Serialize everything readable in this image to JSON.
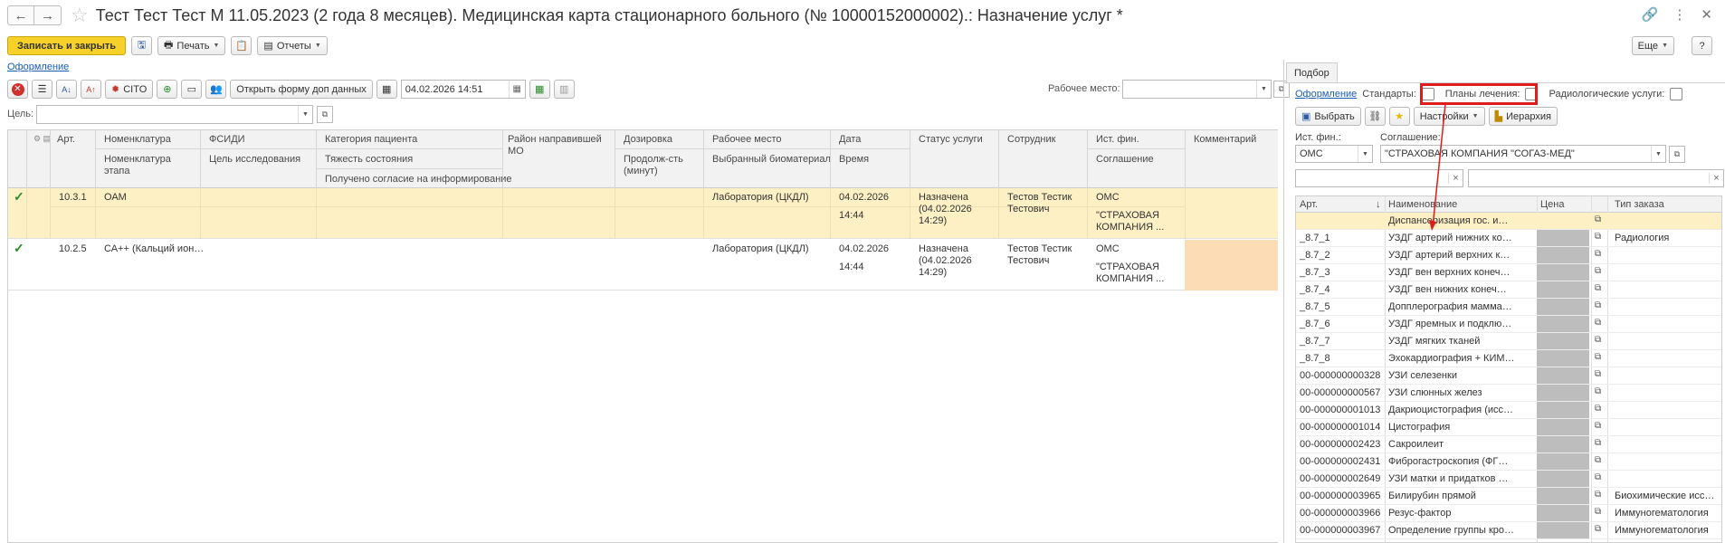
{
  "window": {
    "title": "Тест Тест Тест М 11.05.2023 (2 года 8 месяцев). Медицинская карта стационарного больного (№ 10000152000002).: Назначение услуг *"
  },
  "toolbar": {
    "save_close": "Записать и закрыть",
    "print": "Печать",
    "reports": "Отчеты",
    "more": "Еще",
    "help": "?"
  },
  "oformlenie": "Оформление",
  "toolbar2": {
    "cito": "CITO",
    "open_form": "Открыть форму доп данных",
    "date": "04.02.2026 14:51",
    "workplace_label": "Рабочее место:",
    "workplace_value": ""
  },
  "goal_label": "Цель:",
  "table": {
    "headers": {
      "art": "Арт.",
      "nomenclature": "Номенклатура",
      "nomenclature_stage": "Номенклатура",
      "nomenclature_stage2": "этапа",
      "fsidi": "ФСИДИ",
      "goal": "Цель исследования",
      "patient_cat": "Категория пациента",
      "severity": "Тяжесть состояния",
      "consent": "Получено согласие на информирование",
      "district": "Район направившей",
      "district2": "МО",
      "dosage": "Дозировка",
      "duration": "Продолж-сть",
      "duration2": "(минут)",
      "workplace": "Рабочее место",
      "biomaterial": "Выбранный биоматериал",
      "date": "Дата",
      "time": "Время",
      "status": "Статус услуги",
      "employee": "Сотрудник",
      "fin_source": "Ист. фин.",
      "agreement": "Соглашение",
      "comment": "Комментарий"
    },
    "rows": [
      {
        "art": "10.3.1",
        "nomenclature": "ОАМ",
        "workplace": "Лаборатория (ЦКДЛ)",
        "date": "04.02.2026",
        "time": "14:44",
        "status1": "Назначена",
        "status2": "(04.02.2026",
        "status3": "14:29)",
        "employee1": "Тестов Тестик",
        "employee2": "Тестович",
        "fin": "ОМС",
        "agreement1": "\"СТРАХОВАЯ",
        "agreement2": "КОМПАНИЯ ..."
      },
      {
        "art": "10.2.5",
        "nomenclature": "СА++ (Кальций ион…",
        "workplace": "Лаборатория (ЦКДЛ)",
        "date": "04.02.2026",
        "time": "14:44",
        "status1": "Назначена",
        "status2": "(04.02.2026",
        "status3": "14:29)",
        "employee1": "Тестов Тестик",
        "employee2": "Тестович",
        "fin": "ОМС",
        "agreement1": "\"СТРАХОВАЯ",
        "agreement2": "КОМПАНИЯ ..."
      }
    ]
  },
  "panel": {
    "tab": "Подбор",
    "oformlenie": "Оформление",
    "standards": "Стандарты:",
    "treatment_plans": "Планы лечения:",
    "radiology": "Радиологические услуги:",
    "select": "Выбрать",
    "settings": "Настройки",
    "hierarchy": "Иерархия",
    "fin_label": "Ист. фин.:",
    "fin_value": "ОМС",
    "agreement_label": "Соглашение:",
    "agreement_value": "\"СТРАХОВАЯ КОМПАНИЯ \"СОГАЗ-МЕД\"",
    "headers": {
      "art": "Арт.",
      "sort": "↓",
      "name": "Наименование",
      "price": "Цена",
      "order_type": "Тип заказа"
    },
    "items": [
      {
        "art": "",
        "name": "Диспансеризация гос. и…",
        "type": ""
      },
      {
        "art": "_8.7_1",
        "name": "УЗДГ артерий нижних ко…",
        "type": "Радиология"
      },
      {
        "art": "_8.7_2",
        "name": "УЗДГ артерий верхних к…",
        "type": ""
      },
      {
        "art": "_8.7_3",
        "name": "УЗДГ вен верхних конеч…",
        "type": ""
      },
      {
        "art": "_8.7_4",
        "name": "УЗДГ вен нижних конеч…",
        "type": ""
      },
      {
        "art": "_8.7_5",
        "name": "Допплерография маммa…",
        "type": ""
      },
      {
        "art": "_8.7_6",
        "name": "УЗДГ яремных и подклю…",
        "type": ""
      },
      {
        "art": "_8.7_7",
        "name": "УЗДГ мягких тканей",
        "type": ""
      },
      {
        "art": "_8.7_8",
        "name": "Эхокардиография + КИМ…",
        "type": ""
      },
      {
        "art": "00-000000000328",
        "name": "УЗИ селезенки",
        "type": ""
      },
      {
        "art": "00-000000000567",
        "name": "УЗИ слюнных желез",
        "type": ""
      },
      {
        "art": "00-000000001013",
        "name": "Дакриоцистография (исс…",
        "type": ""
      },
      {
        "art": "00-000000001014",
        "name": "Цистография",
        "type": ""
      },
      {
        "art": "00-000000002423",
        "name": "Сакроилеит",
        "type": ""
      },
      {
        "art": "00-000000002431",
        "name": "Фиброгастроскопия (ФГ…",
        "type": ""
      },
      {
        "art": "00-000000002649",
        "name": "УЗИ матки и придатков …",
        "type": ""
      },
      {
        "art": "00-000000003965",
        "name": "Билирубин прямой",
        "type": "Биохимические исс…"
      },
      {
        "art": "00-000000003966",
        "name": "Резус-фактор",
        "type": "Иммуногематология"
      },
      {
        "art": "00-000000003967",
        "name": "Определение группы кро…",
        "type": "Иммуногематология"
      }
    ]
  }
}
